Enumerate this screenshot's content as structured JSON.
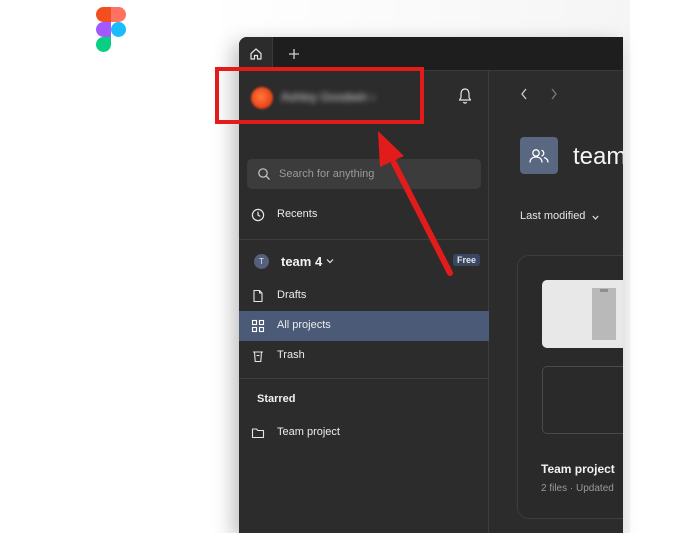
{
  "colors": {
    "app_bg": "#2c2c2c",
    "tabbar_bg": "#1e1e1e",
    "active_nav": "#4b5a76",
    "annotation_red": "#e21b1b",
    "figma_red": "#f24e1e",
    "figma_orange": "#ff7262",
    "figma_purple": "#a259ff",
    "figma_blue": "#1abcfe",
    "figma_green": "#0acf83"
  },
  "tabs": {
    "home_icon": "home-icon",
    "add_icon": "plus-icon"
  },
  "sidebar": {
    "account": {
      "name": "Ashley Goodwin",
      "chevron": "›"
    },
    "search": {
      "placeholder": "Search for anything"
    },
    "recents_label": "Recents",
    "team": {
      "badge": "T",
      "name": "team 4",
      "plan_badge": "Free"
    },
    "items": [
      {
        "label": "Drafts",
        "icon": "file-icon"
      },
      {
        "label": "All projects",
        "icon": "grid-icon",
        "active": true
      },
      {
        "label": "Trash",
        "icon": "trash-icon"
      }
    ],
    "starred": {
      "heading": "Starred",
      "items": [
        {
          "label": "Team project",
          "icon": "folder-icon"
        }
      ]
    }
  },
  "main": {
    "title": "team",
    "sort_label": "Last modified",
    "project": {
      "title": "Team project",
      "meta": "2 files · Updated"
    }
  }
}
